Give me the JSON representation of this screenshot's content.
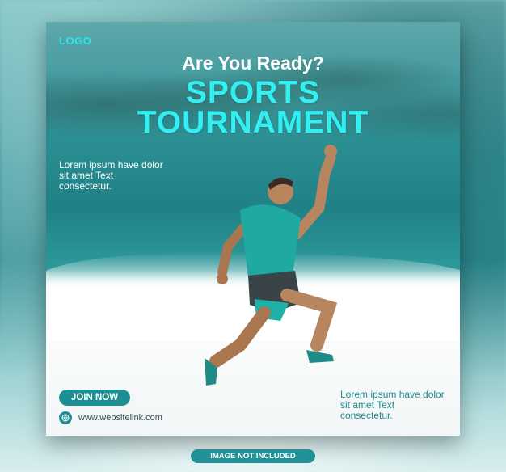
{
  "card": {
    "logo": "LOGO",
    "headline": "Are You Ready?",
    "title_line1": "SPORTS",
    "title_line2": "TOURNAMENT",
    "description_left": "Lorem ipsum have dolor sit amet Text consectetur.",
    "description_right": "Lorem ipsum have dolor sit amet Text consectetur.",
    "cta_label": "JOIN NOW",
    "website": "www.websitelink.com",
    "icons": [
      "globe-icon"
    ]
  },
  "footer_badge": "IMAGE NOT INCLUDED",
  "colors": {
    "accent": "#32f0f2",
    "teal": "#1d8f93",
    "text_dark": "#2f4d4f"
  }
}
